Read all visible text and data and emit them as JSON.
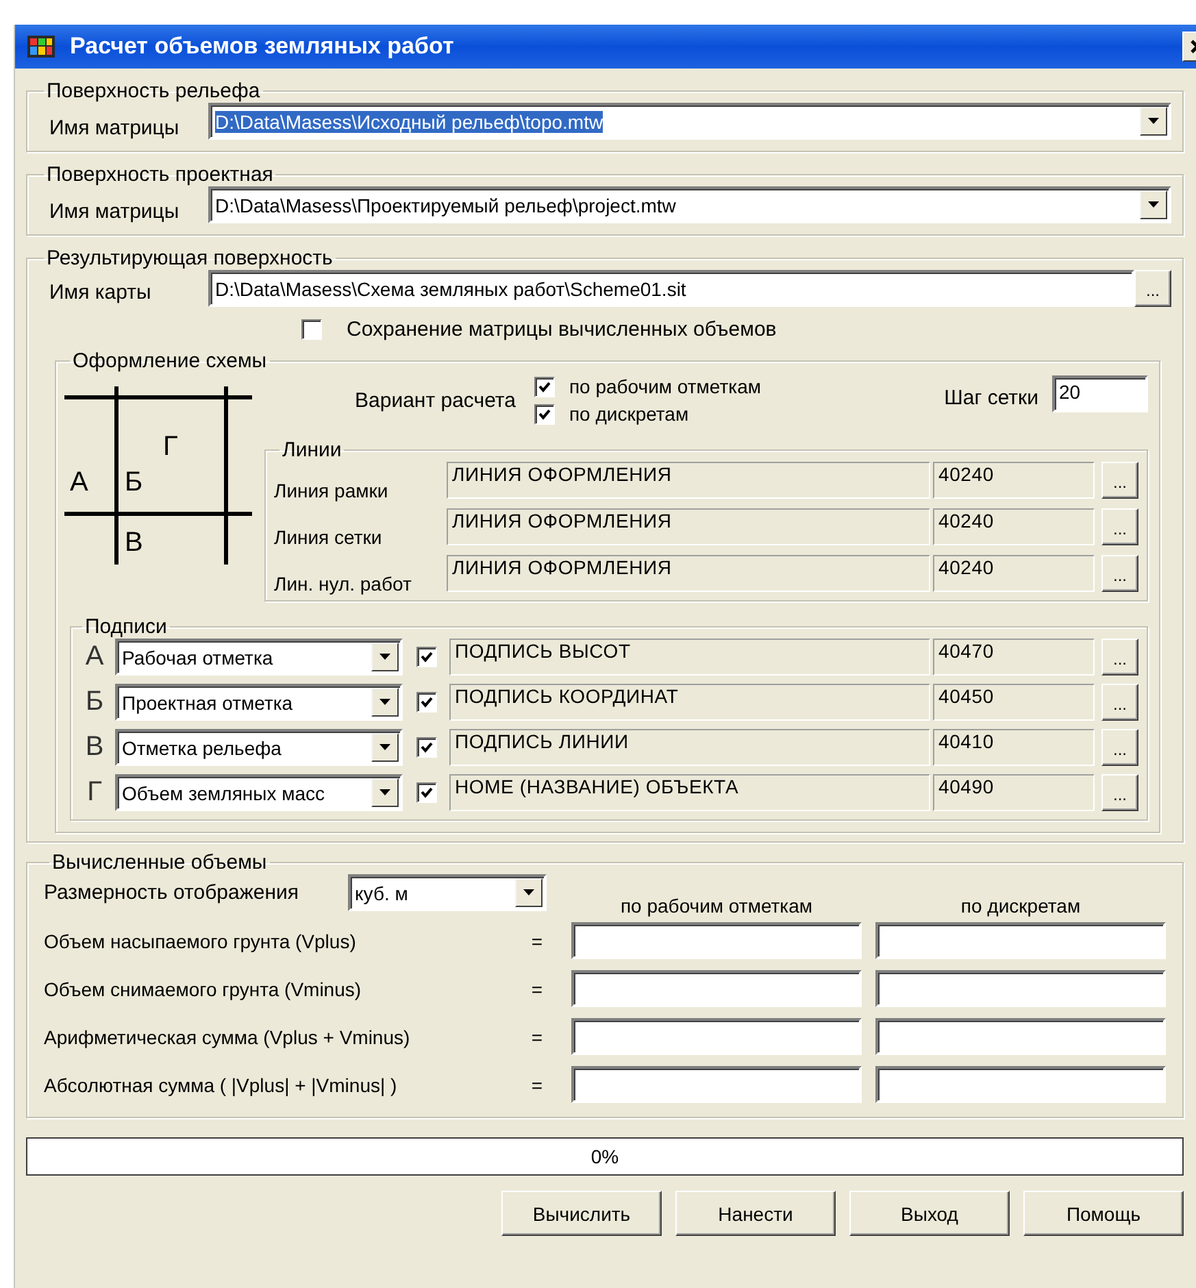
{
  "window": {
    "title": "Расчет объемов земляных работ"
  },
  "relief": {
    "title": "Поверхность рельефа",
    "label": "Имя матрицы",
    "value": "D:\\Data\\Masess\\Исходный рельеф\\topo.mtw",
    "highlighted": true
  },
  "project": {
    "title": "Поверхность проектная",
    "label": "Имя матрицы",
    "value": "D:\\Data\\Masess\\Проектируемый рельеф\\project.mtw",
    "highlighted": false
  },
  "result": {
    "title": "Результирующая поверхность",
    "label": "Имя карты",
    "value": "D:\\Data\\Masess\\Схема земляных работ\\Scheme01.sit",
    "browse": "...",
    "save_matrix": {
      "label": "Сохранение матрицы вычисленных объемов",
      "checked": false
    }
  },
  "scheme": {
    "title": "Оформление схемы",
    "diagram_labels": [
      "А",
      "Б",
      "Г",
      "В"
    ],
    "variant": {
      "label": "Вариант расчета",
      "options": [
        {
          "label": "по рабочим отметкам",
          "checked": true
        },
        {
          "label": "по дискретам",
          "checked": true
        }
      ]
    },
    "grid_step": {
      "label": "Шаг сетки",
      "value": "20"
    },
    "lines": {
      "title": "Линии",
      "rows": [
        {
          "label": "Линия рамки",
          "name": "ЛИНИЯ ОФОРМЛЕНИЯ",
          "code": "40240",
          "browse": "..."
        },
        {
          "label": "Линия сетки",
          "name": "ЛИНИЯ ОФОРМЛЕНИЯ",
          "code": "40240",
          "browse": "..."
        },
        {
          "label": "Лин. нул. работ",
          "name": "ЛИНИЯ ОФОРМЛЕНИЯ",
          "code": "40240",
          "browse": "..."
        }
      ]
    },
    "captions": {
      "title": "Подписи",
      "rows": [
        {
          "letter": "А",
          "value": "Рабочая отметка",
          "checked": true,
          "name": "ПОДПИСЬ ВЫСОТ",
          "code": "40470",
          "browse": "..."
        },
        {
          "letter": "Б",
          "value": "Проектная отметка",
          "checked": true,
          "name": "ПОДПИСЬ КООРДИНАТ",
          "code": "40450",
          "browse": "..."
        },
        {
          "letter": "В",
          "value": "Отметка рельефа",
          "checked": true,
          "name": "ПОДПИСЬ ЛИНИИ",
          "code": "40410",
          "browse": "..."
        },
        {
          "letter": "Г",
          "value": "Объем земляных масс",
          "checked": true,
          "name": "НОМЕ (НАЗВАНИЕ) ОБЪЕКТА",
          "code": "40490",
          "browse": "..."
        }
      ]
    }
  },
  "volumes": {
    "title": "Вычисленные объемы",
    "units_label": "Размерность отображения",
    "units": "куб. м",
    "columns": [
      "по рабочим отметкам",
      "по дискретам"
    ],
    "rows": [
      {
        "label": "Объем насыпаемого грунта (Vplus)",
        "sign": "="
      },
      {
        "label": "Объем снимаемого грунта (Vminus)",
        "sign": "="
      },
      {
        "label": "Арифметическая сумма (Vplus + Vminus)",
        "sign": "="
      },
      {
        "label": "Абсолютная сумма ( |Vplus| + |Vminus| )",
        "sign": "="
      }
    ]
  },
  "progress": {
    "level": 0,
    "text": "0%"
  },
  "buttons": [
    "Вычислить",
    "Нанести",
    "Выход",
    "Помощь"
  ]
}
